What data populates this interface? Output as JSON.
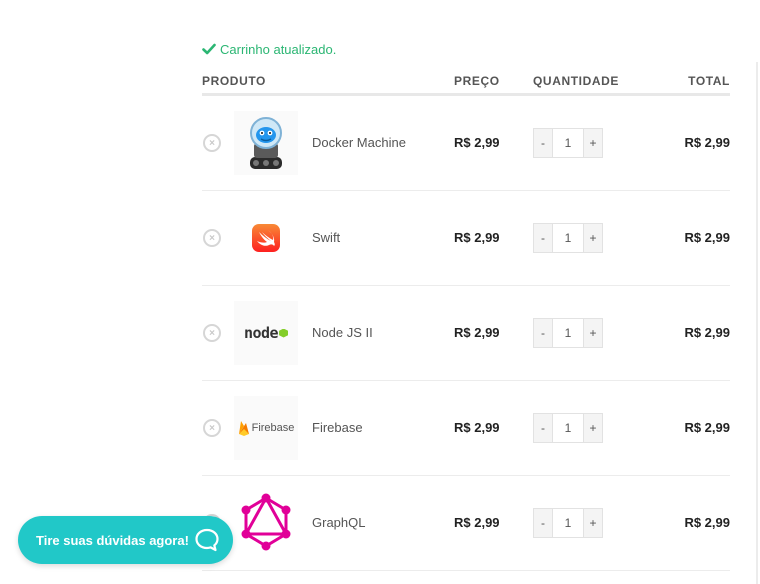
{
  "notice": {
    "text": "Carrinho atualizado.",
    "icon": "check-icon",
    "color": "#2bb673"
  },
  "table": {
    "headers": {
      "product": "PRODUTO",
      "price": "PREÇO",
      "quantity": "QUANTIDADE",
      "total": "TOTAL"
    },
    "rows": [
      {
        "name": "Docker Machine",
        "price": "R$ 2,99",
        "quantity": "1",
        "total": "R$ 2,99",
        "image": "docker-machine-logo"
      },
      {
        "name": "Swift",
        "price": "R$ 2,99",
        "quantity": "1",
        "total": "R$ 2,99",
        "image": "swift-logo"
      },
      {
        "name": "Node JS II",
        "price": "R$ 2,99",
        "quantity": "1",
        "total": "R$ 2,99",
        "image": "nodejs-logo"
      },
      {
        "name": "Firebase",
        "price": "R$ 2,99",
        "quantity": "1",
        "total": "R$ 2,99",
        "image": "firebase-logo"
      },
      {
        "name": "GraphQL",
        "price": "R$ 2,99",
        "quantity": "1",
        "total": "R$ 2,99",
        "image": "graphql-logo"
      }
    ],
    "remove_symbol": "×",
    "minus_label": "-",
    "plus_label": "+"
  },
  "logos": {
    "nodejs_text": "node",
    "firebase_text": "Firebase"
  },
  "chat": {
    "label": "Tire suas dúvidas agora!",
    "icon": "chat-bubble-icon",
    "color": "#21c8c8"
  }
}
